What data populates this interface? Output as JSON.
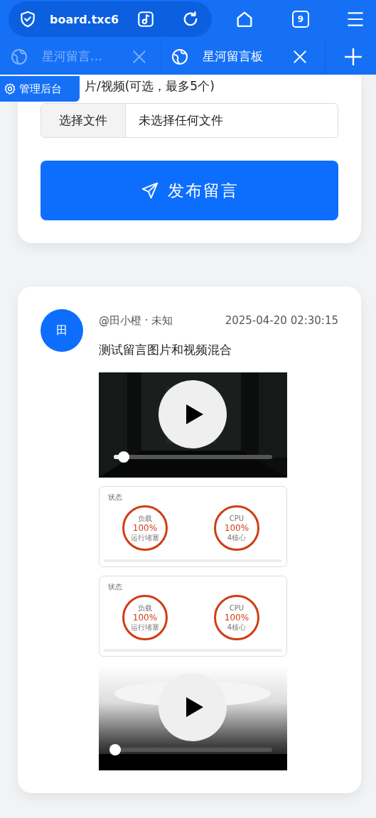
{
  "browser": {
    "url": "board.txc6",
    "tab_count": "9"
  },
  "tabs": [
    {
      "title": "星河留言…",
      "selected": false
    },
    {
      "title": "星河留言板",
      "selected": true
    }
  ],
  "admin_button": {
    "label": "管理后台"
  },
  "upload_form": {
    "label": "片/视频(可选，最多5个)",
    "file_button": "选择文件",
    "file_status": "未选择任何文件",
    "submit_button": "发布留言"
  },
  "posts": [
    {
      "avatar": "田",
      "author": "@田小橙 · 未知",
      "time": "2025-04-20 02:30:15",
      "text": "测试留言图片和视频混合",
      "media": [
        {
          "kind": "video",
          "level": 0.09
        },
        {
          "kind": "status",
          "title": "状态",
          "gauges": [
            {
              "label": "负载",
              "value": "100%",
              "sub": "运行堵塞"
            },
            {
              "label": "CPU",
              "value": "100%",
              "sub": "4核心"
            }
          ]
        },
        {
          "kind": "status",
          "title": "状态",
          "gauges": [
            {
              "label": "负载",
              "value": "100%",
              "sub": "运行堵塞"
            },
            {
              "label": "CPU",
              "value": "100%",
              "sub": "4核心"
            }
          ]
        },
        {
          "kind": "video",
          "level": 0.04
        }
      ]
    }
  ]
}
